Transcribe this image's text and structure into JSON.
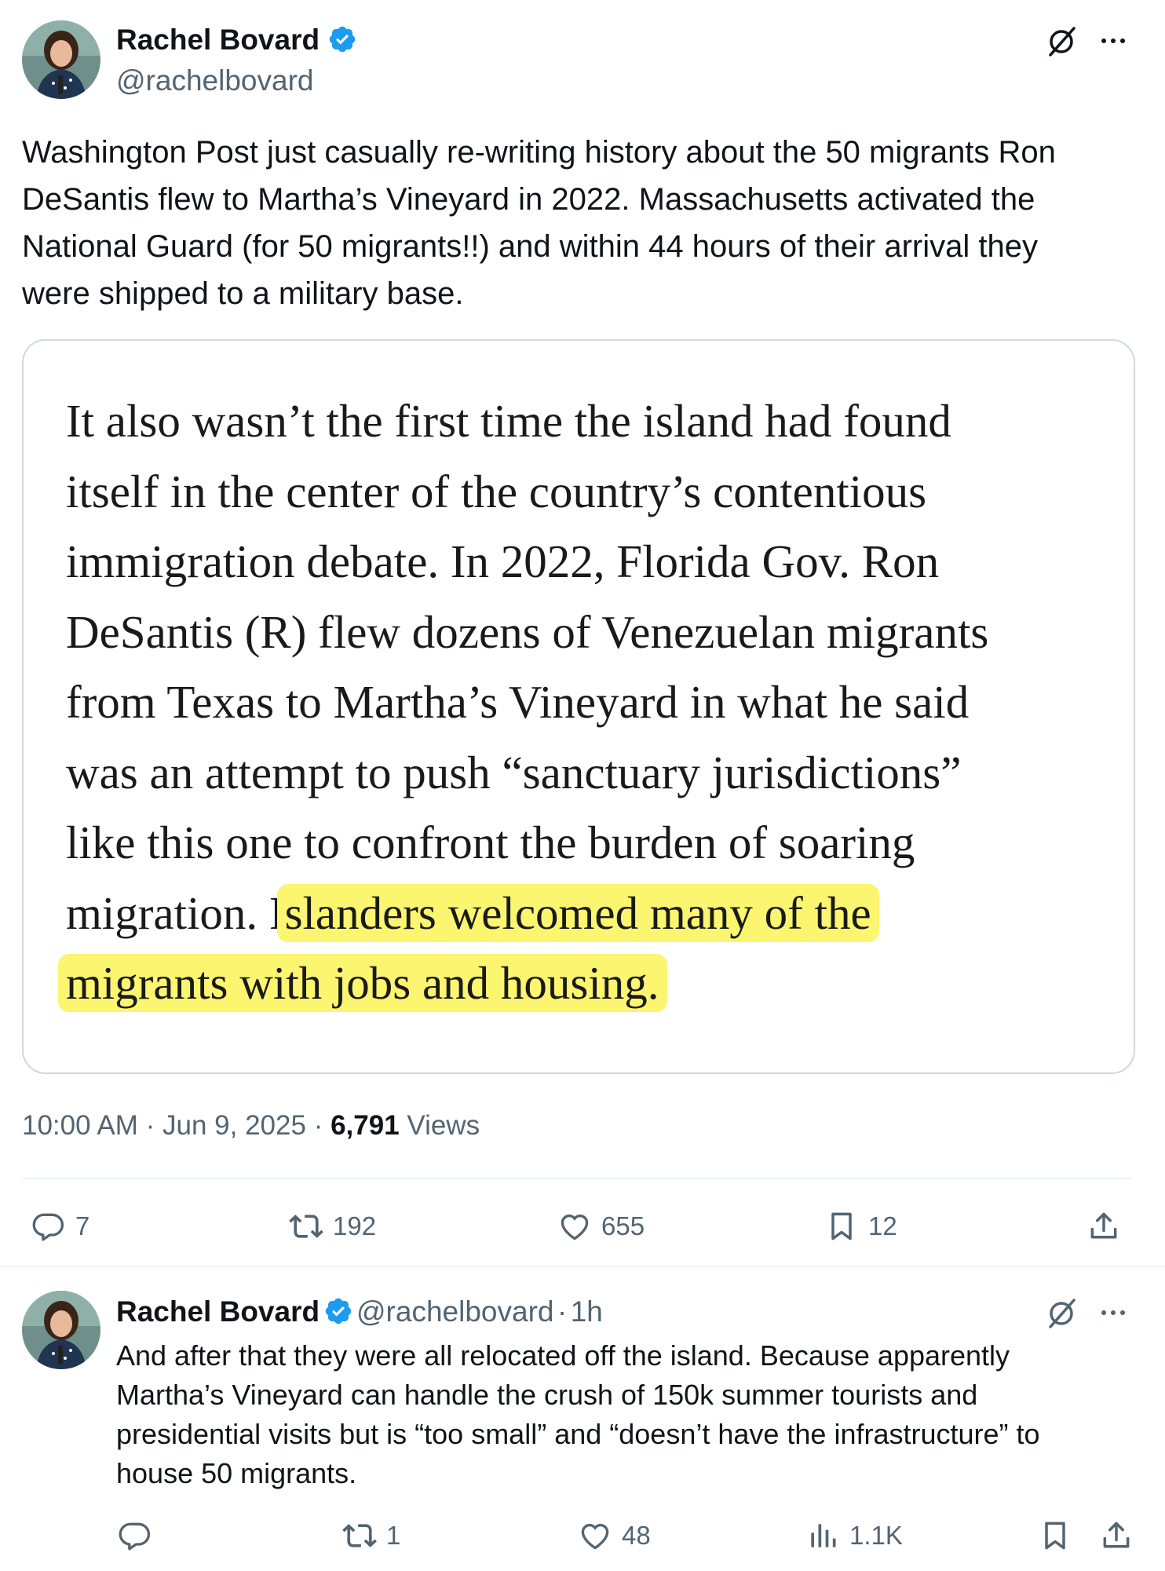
{
  "main_tweet": {
    "author": {
      "name": "Rachel Bovard",
      "handle": "@rachelbovard"
    },
    "text": "Washington Post just casually re-writing history about the 50 migrants Ron DeSantis flew to Martha’s Vineyard in 2022. Massachusetts activated the National Guard (for 50 migrants!!) and within 44 hours of their arrival they were shipped to a military base.",
    "text_lines": [
      "Washington Post just casually re-writing history about the 50 migrants Ron",
      "DeSantis flew to Martha’s Vineyard in 2022. Massachusetts activated the",
      "National Guard (for 50 migrants!!) and within 44 hours of their arrival they",
      "were shipped to a military base."
    ],
    "quote_lines": [
      "It also wasn’t the first time the island had found",
      "itself in the center of the country’s contentious",
      "immigration debate. In 2022, Florida Gov. Ron",
      "DeSantis (R) flew dozens of Venezuelan migrants",
      "from Texas to Martha’s Vineyard in what he said",
      "was an attempt to push “sanctuary jurisdictions”",
      "like this one to confront the burden of soaring"
    ],
    "quote_line8_plain": "migration. I",
    "quote_line8_highlight": "slanders welcomed many of the",
    "quote_line9_highlight": "migrants with jobs and housing.",
    "time": "10:00 AM",
    "date": "Jun 9, 2025",
    "views_count": "6,791",
    "views_label": "Views",
    "actions": {
      "replies": "7",
      "reposts": "192",
      "likes": "655",
      "bookmarks": "12"
    }
  },
  "reply_tweet": {
    "author": {
      "name": "Rachel Bovard",
      "handle": "@rachelbovard"
    },
    "time_ago": "1h",
    "text_lines": [
      "And after that they were all relocated off the island. Because apparently",
      "Martha’s Vineyard can handle the crush of 150k summer tourists and",
      "presidential visits but is “too small” and “doesn’t have the infrastructure” to",
      "house 50 migrants."
    ],
    "actions": {
      "reposts": "1",
      "likes": "48",
      "views": "1.1K"
    }
  },
  "separator": "·",
  "colors": {
    "verified": "#1d9bf0",
    "highlight": "#fbf570",
    "muted": "#536471",
    "text": "#0f1419",
    "border": "#cfd9de"
  },
  "icons": [
    "verified-badge-icon",
    "grok-icon",
    "more-icon",
    "reply-icon",
    "repost-icon",
    "like-icon",
    "bookmark-icon",
    "share-icon",
    "views-icon"
  ]
}
